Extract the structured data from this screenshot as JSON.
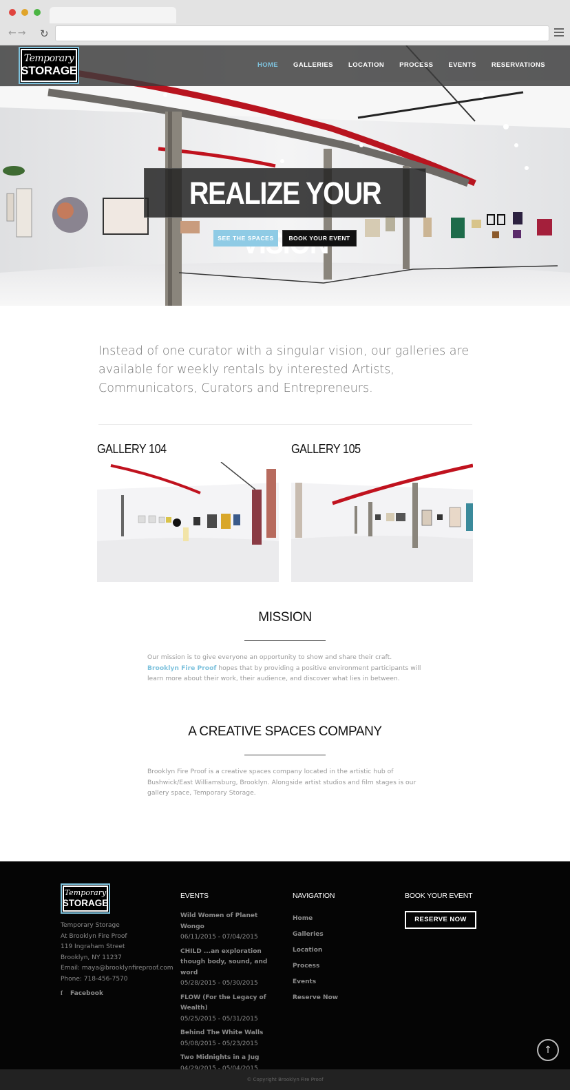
{
  "site": {
    "logo": {
      "line1": "Temporary",
      "line2": "STORAGE"
    },
    "nav": [
      "HOME",
      "GALLERIES",
      "LOCATION",
      "PROCESS",
      "EVENTS",
      "RESERVATIONS"
    ],
    "active_nav": "HOME"
  },
  "hero": {
    "headline": "REALIZE YOUR VISION",
    "btn_spaces": "SEE THE SPACES",
    "btn_event": "BOOK YOUR EVENT"
  },
  "intro": "Instead of one curator with a singular vision, our galleries are available for weekly rentals by interested Artists, Communicators, Curators and Entrepreneurs.",
  "galleries": [
    {
      "title": "GALLERY 104"
    },
    {
      "title": "GALLERY 105"
    }
  ],
  "mission": {
    "title": "MISSION",
    "text_before": "Our mission is to give everyone an opportunity to show and share their craft. ",
    "link": "Brooklyn Fire Proof",
    "text_after": " hopes that by providing a positive environment participants will learn more about their work, their audience, and discover what lies in between."
  },
  "company": {
    "title": "A CREATIVE SPACES COMPANY",
    "text": "Brooklyn Fire Proof is a creative spaces company located in the artistic hub of Bushwick/East Williamsburg, Brooklyn. Alongside artist studios and film stages is our gallery space, Temporary Storage."
  },
  "footer": {
    "address": [
      "Temporary Storage",
      "At Brooklyn Fire Proof",
      "119 Ingraham Street",
      "Brooklyn, NY 11237",
      "Email: maya@brooklynfireproof.com",
      "Phone: 718-456-7570"
    ],
    "facebook": "Facebook",
    "events_heading": "EVENTS",
    "events": [
      {
        "title": "Wild Women of Planet Wongo",
        "dates": "06/11/2015 - 07/04/2015"
      },
      {
        "title": "CHILD ...an exploration though body, sound, and word",
        "dates": "05/28/2015 - 05/30/2015"
      },
      {
        "title": "FLOW (For the Legacy of Wealth)",
        "dates": "05/25/2015 - 05/31/2015"
      },
      {
        "title": "Behind The White Walls",
        "dates": "05/08/2015 - 05/23/2015"
      },
      {
        "title": "Two Midnights in a Jug",
        "dates": "04/29/2015 - 05/04/2015"
      }
    ],
    "nav_heading": "NAVIGATION",
    "nav": [
      "Home",
      "Galleries",
      "Location",
      "Process",
      "Events",
      "Reserve Now"
    ],
    "book_heading": "BOOK YOUR EVENT",
    "reserve_btn": "RESERVE NOW",
    "copyright": "© Copyright Brooklyn Fire Proof"
  },
  "colors": {
    "accent": "#7ec2dd",
    "pipe_red": "#c8102e",
    "footer_bg": "#050505"
  }
}
